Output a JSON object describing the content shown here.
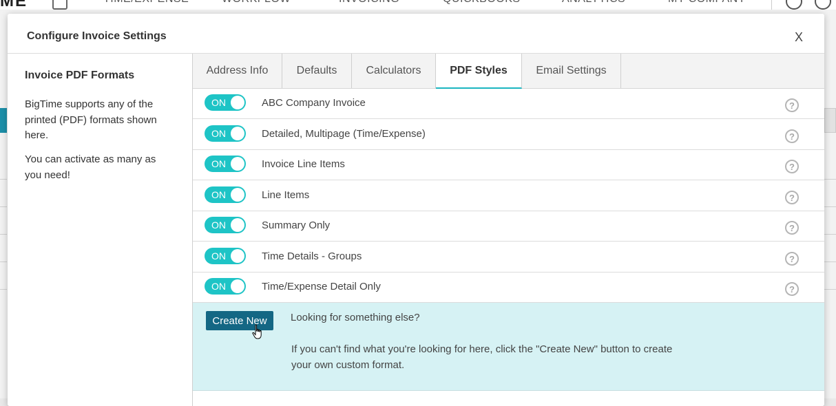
{
  "background_app": {
    "logo": "ME",
    "nav": [
      "TIME/EXPENSE",
      "WORKFLOW",
      "INVOICING",
      "QUICKBOOKS",
      "ANALYTICS",
      "MY COMPANY"
    ]
  },
  "modal": {
    "title": "Configure Invoice Settings",
    "close_label": "X",
    "left_panel": {
      "heading": "Invoice PDF Formats",
      "description_1": "BigTime supports any of the printed (PDF) formats shown here.",
      "description_2": "You can activate as many as you need!"
    },
    "tabs": [
      {
        "label": "Address Info",
        "active": false
      },
      {
        "label": "Defaults",
        "active": false
      },
      {
        "label": "Calculators",
        "active": false
      },
      {
        "label": "PDF Styles",
        "active": true
      },
      {
        "label": "Email Settings",
        "active": false
      }
    ],
    "formats": [
      {
        "toggle": "ON",
        "name": "ABC Company Invoice"
      },
      {
        "toggle": "ON",
        "name": "Detailed, Multipage (Time/Expense)"
      },
      {
        "toggle": "ON",
        "name": "Invoice Line Items"
      },
      {
        "toggle": "ON",
        "name": "Line Items"
      },
      {
        "toggle": "ON",
        "name": "Summary Only"
      },
      {
        "toggle": "ON",
        "name": "Time Details - Groups"
      },
      {
        "toggle": "ON",
        "name": "Time/Expense Detail Only"
      }
    ],
    "help_glyph": "?",
    "create_section": {
      "button_label": "Create New",
      "question": "Looking for something else?",
      "description": "If you can't find what you're looking for here, click the \"Create New\" button to create your own custom format."
    }
  },
  "colors": {
    "toggle_on": "#1ec4c6",
    "tab_active_underline": "#1ab5c0",
    "create_button": "#146784",
    "create_panel_bg": "#d6f2f4"
  },
  "icons": [
    "home-icon",
    "user-icon",
    "clock-icon",
    "help-icon",
    "hand-cursor-icon"
  ]
}
